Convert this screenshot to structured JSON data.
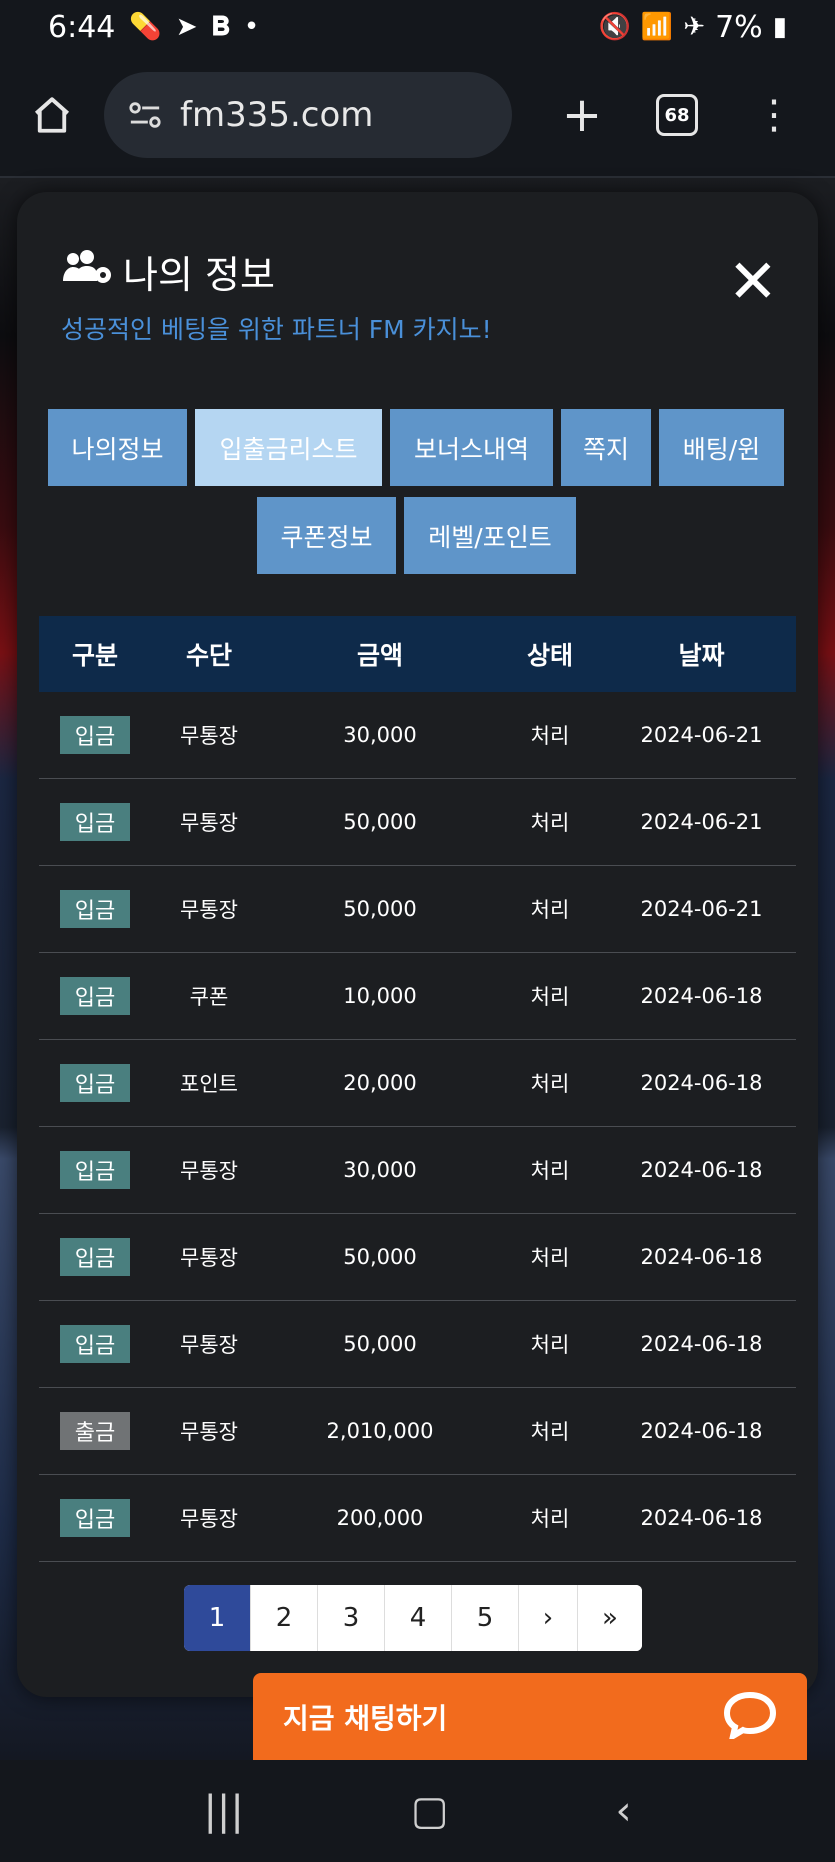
{
  "status_bar": {
    "time": "6:44",
    "battery": "7%"
  },
  "browser": {
    "url": "fm335.com",
    "tab_count": "68"
  },
  "modal": {
    "title": "나의 정보",
    "subtitle": "성공적인 베팅을 위한 파트너 FM 카지노!",
    "tabs_row1": [
      "나의정보",
      "입출금리스트",
      "보너스내역",
      "쪽지",
      "배팅/윈"
    ],
    "tabs_row2": [
      "쿠폰정보",
      "레벨/포인트"
    ],
    "active_tab": "입출금리스트"
  },
  "table": {
    "headers": [
      "구분",
      "수단",
      "금액",
      "상태",
      "날짜"
    ],
    "rows": [
      {
        "type": "입금",
        "method": "무통장",
        "amount": "30,000",
        "status": "처리",
        "date": "2024-06-21"
      },
      {
        "type": "입금",
        "method": "무통장",
        "amount": "50,000",
        "status": "처리",
        "date": "2024-06-21"
      },
      {
        "type": "입금",
        "method": "무통장",
        "amount": "50,000",
        "status": "처리",
        "date": "2024-06-21"
      },
      {
        "type": "입금",
        "method": "쿠폰",
        "amount": "10,000",
        "status": "처리",
        "date": "2024-06-18"
      },
      {
        "type": "입금",
        "method": "포인트",
        "amount": "20,000",
        "status": "처리",
        "date": "2024-06-18"
      },
      {
        "type": "입금",
        "method": "무통장",
        "amount": "30,000",
        "status": "처리",
        "date": "2024-06-18"
      },
      {
        "type": "입금",
        "method": "무통장",
        "amount": "50,000",
        "status": "처리",
        "date": "2024-06-18"
      },
      {
        "type": "입금",
        "method": "무통장",
        "amount": "50,000",
        "status": "처리",
        "date": "2024-06-18"
      },
      {
        "type": "출금",
        "method": "무통장",
        "amount": "2,010,000",
        "status": "처리",
        "date": "2024-06-18"
      },
      {
        "type": "입금",
        "method": "무통장",
        "amount": "200,000",
        "status": "처리",
        "date": "2024-06-18"
      }
    ]
  },
  "pagination": {
    "pages": [
      "1",
      "2",
      "3",
      "4",
      "5",
      "›",
      "»"
    ],
    "current": "1"
  },
  "chat": {
    "label": "지금 채팅하기"
  },
  "colors": {
    "accent_blue": "#4a90d9",
    "tab_blue": "#5f95c9",
    "tab_active": "#b5d6f2",
    "table_header": "#0e2a4a",
    "deposit_badge": "#4a7f7f",
    "withdraw_badge": "#707375",
    "chat_orange": "#f26b1d"
  }
}
